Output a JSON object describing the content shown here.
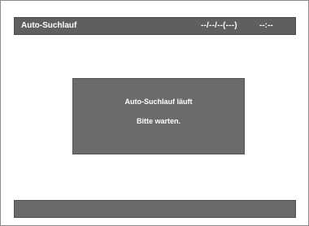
{
  "header": {
    "title": "Auto-Suchlauf",
    "date": "--/--/--(---)",
    "time": "--:--"
  },
  "dialog": {
    "line1": "Auto-Suchlauf läuft",
    "line2": "Bitte warten."
  },
  "colors": {
    "bar": "#5f5f5f",
    "dialog": "#6b6b6b",
    "text": "#ffffff",
    "background": "#ffffff"
  }
}
